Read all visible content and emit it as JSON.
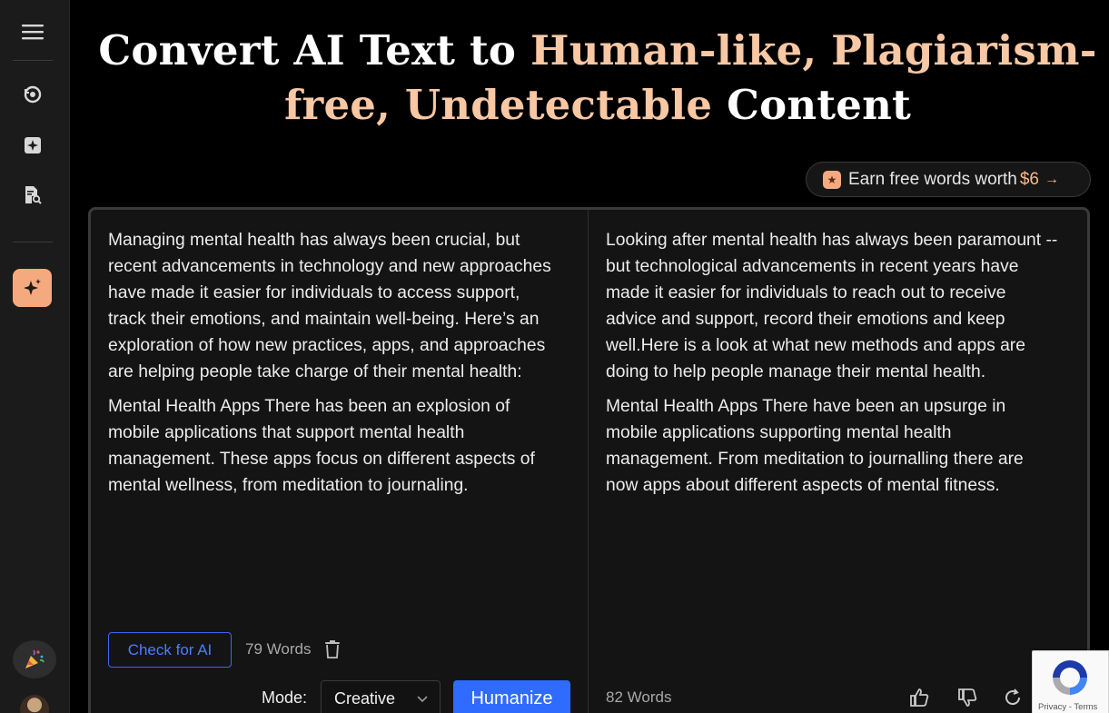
{
  "headline": {
    "part1": "Convert AI Text to ",
    "accent1": "Human-like, Plagiarism-free, Undetectable",
    "part2": " Content"
  },
  "earn": {
    "label": "Earn free words worth",
    "amount": "$6",
    "arrow": "→"
  },
  "input_text": {
    "paragraphs": [
      "Managing mental health has always been crucial, but recent advancements in technology and new approaches have made it easier for individuals to access support, track their emotions, and maintain well-being. Here’s an exploration of how new practices, apps, and approaches are helping people take charge of their mental health:",
      "Mental Health Apps There has been an explosion of mobile applications that support mental health management. These apps focus on different aspects of mental wellness, from meditation to journaling."
    ],
    "word_count": "79 Words"
  },
  "output_text": {
    "paragraphs": [
      "Looking after mental health has always been paramount -- but technological advancements in recent years have made it easier for individuals to reach out to receive advice and support, record their emotions and keep well.Here is a look at what new methods and apps are doing to help people manage their mental health.",
      "Mental Health Apps There have been an upsurge in mobile applications supporting mental health management. From meditation to journalling there are now apps about different aspects of mental fitness."
    ],
    "word_count": "82 Words"
  },
  "controls": {
    "check_ai_label": "Check for AI",
    "mode_label": "Mode:",
    "mode_value": "Creative",
    "humanize_label": "Humanize"
  },
  "recaptcha": {
    "links": "Privacy - Terms"
  },
  "colors": {
    "accent_peach": "#f8c7a3",
    "primary_blue": "#2f6bff",
    "sidebar_active": "#f5a97f"
  },
  "icons": {
    "sidebar": [
      "menu-icon",
      "refresh-ai-icon",
      "plus-square-icon",
      "doc-search-icon",
      "sparkle-icon"
    ],
    "avatar": "party-popper-icon",
    "feedback": [
      "thumbs-up-icon",
      "thumbs-down-icon",
      "regenerate-icon"
    ]
  }
}
